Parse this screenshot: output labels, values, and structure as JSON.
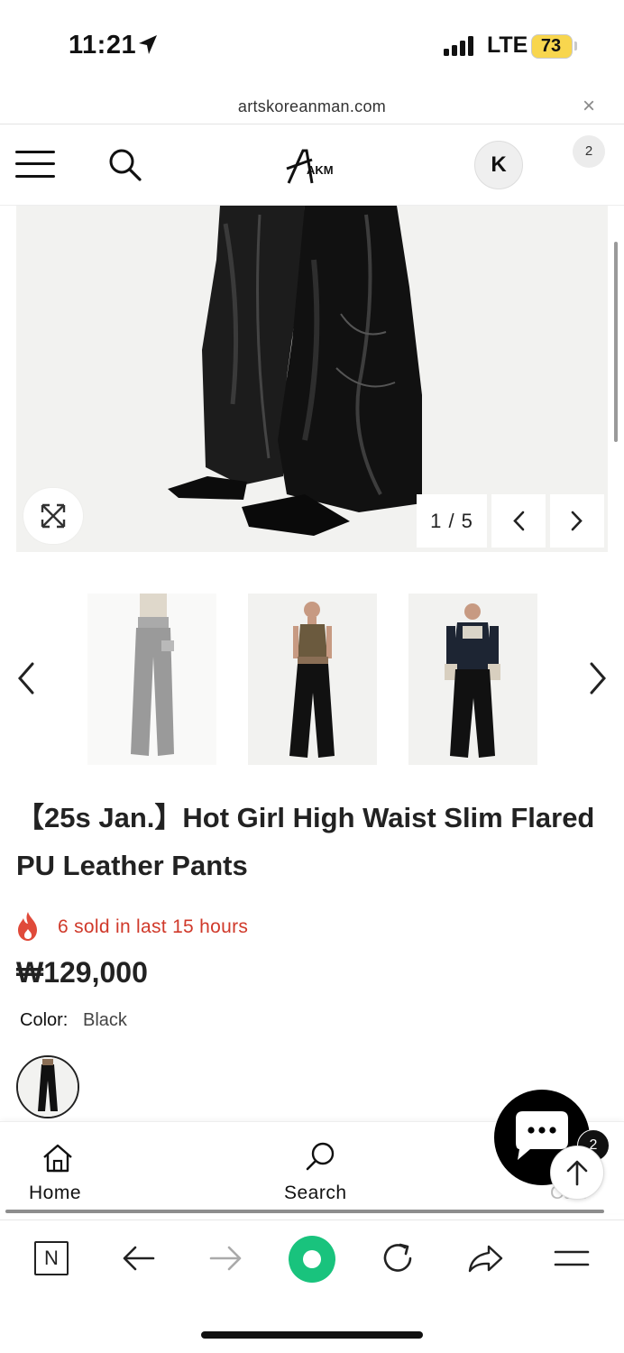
{
  "status_bar": {
    "time": "11:21",
    "network": "LTE",
    "battery": "73"
  },
  "browser": {
    "url": "artskoreanman.com",
    "close_symbol": "×"
  },
  "header": {
    "logo_text": "AKM",
    "account_initial": "K",
    "cart_count": "2"
  },
  "gallery": {
    "counter": "1 / 5",
    "thumbnails": [
      "thumbnail-1",
      "thumbnail-2",
      "thumbnail-3"
    ]
  },
  "product": {
    "title": "【25s Jan.】Hot Girl High Waist Slim Flared PU Leather Pants",
    "sold_text": "6 sold in last 15 hours",
    "price": "₩129,000",
    "color_label": "Color:",
    "color_value": "Black"
  },
  "bottom_nav": {
    "home_label": "Home",
    "search_label": "Search",
    "cart_label": "Cart",
    "chat_badge": "2"
  },
  "colors": {
    "sold_red": "#d0392a",
    "battery_yellow": "#f8d64e",
    "green_action": "#19c37d"
  }
}
